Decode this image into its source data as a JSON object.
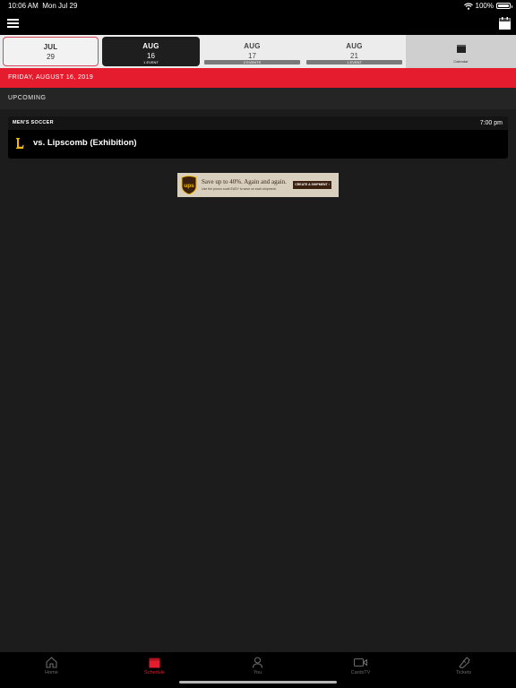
{
  "status_bar": {
    "time": "10:06 AM",
    "date": "Mon Jul 29",
    "battery": "100%"
  },
  "colors": {
    "accent": "#e41c2e",
    "background": "#1c1c1c"
  },
  "date_strip": {
    "items": [
      {
        "month": "JUL",
        "day": "29",
        "events": ""
      },
      {
        "month": "AUG",
        "day": "16",
        "events": "1 EVENT"
      },
      {
        "month": "AUG",
        "day": "17",
        "events": "2 EVENTS"
      },
      {
        "month": "AUG",
        "day": "21",
        "events": "1 EVENT"
      }
    ],
    "calendar_label": "Calendar"
  },
  "day_header": "FRIDAY, AUGUST 16, 2019",
  "section_label": "UPCOMING",
  "event": {
    "sport": "MEN'S SOCCER",
    "time": "7:00 pm",
    "logo_letter": "L",
    "title": "vs. Lipscomb (Exhibition)"
  },
  "ad": {
    "brand": "ups",
    "headline": "Save up to 40%. Again and again.",
    "subtext": "Use the promo code EASY to save on each shipment.",
    "cta": "CREATE A SHIPMENT ›"
  },
  "tabs": [
    {
      "label": "Home",
      "icon": "home-icon"
    },
    {
      "label": "Schedule",
      "icon": "calendar-icon"
    },
    {
      "label": "You",
      "icon": "person-icon"
    },
    {
      "label": "CardsTV",
      "icon": "video-icon"
    },
    {
      "label": "Tickets",
      "icon": "ticket-icon"
    }
  ]
}
